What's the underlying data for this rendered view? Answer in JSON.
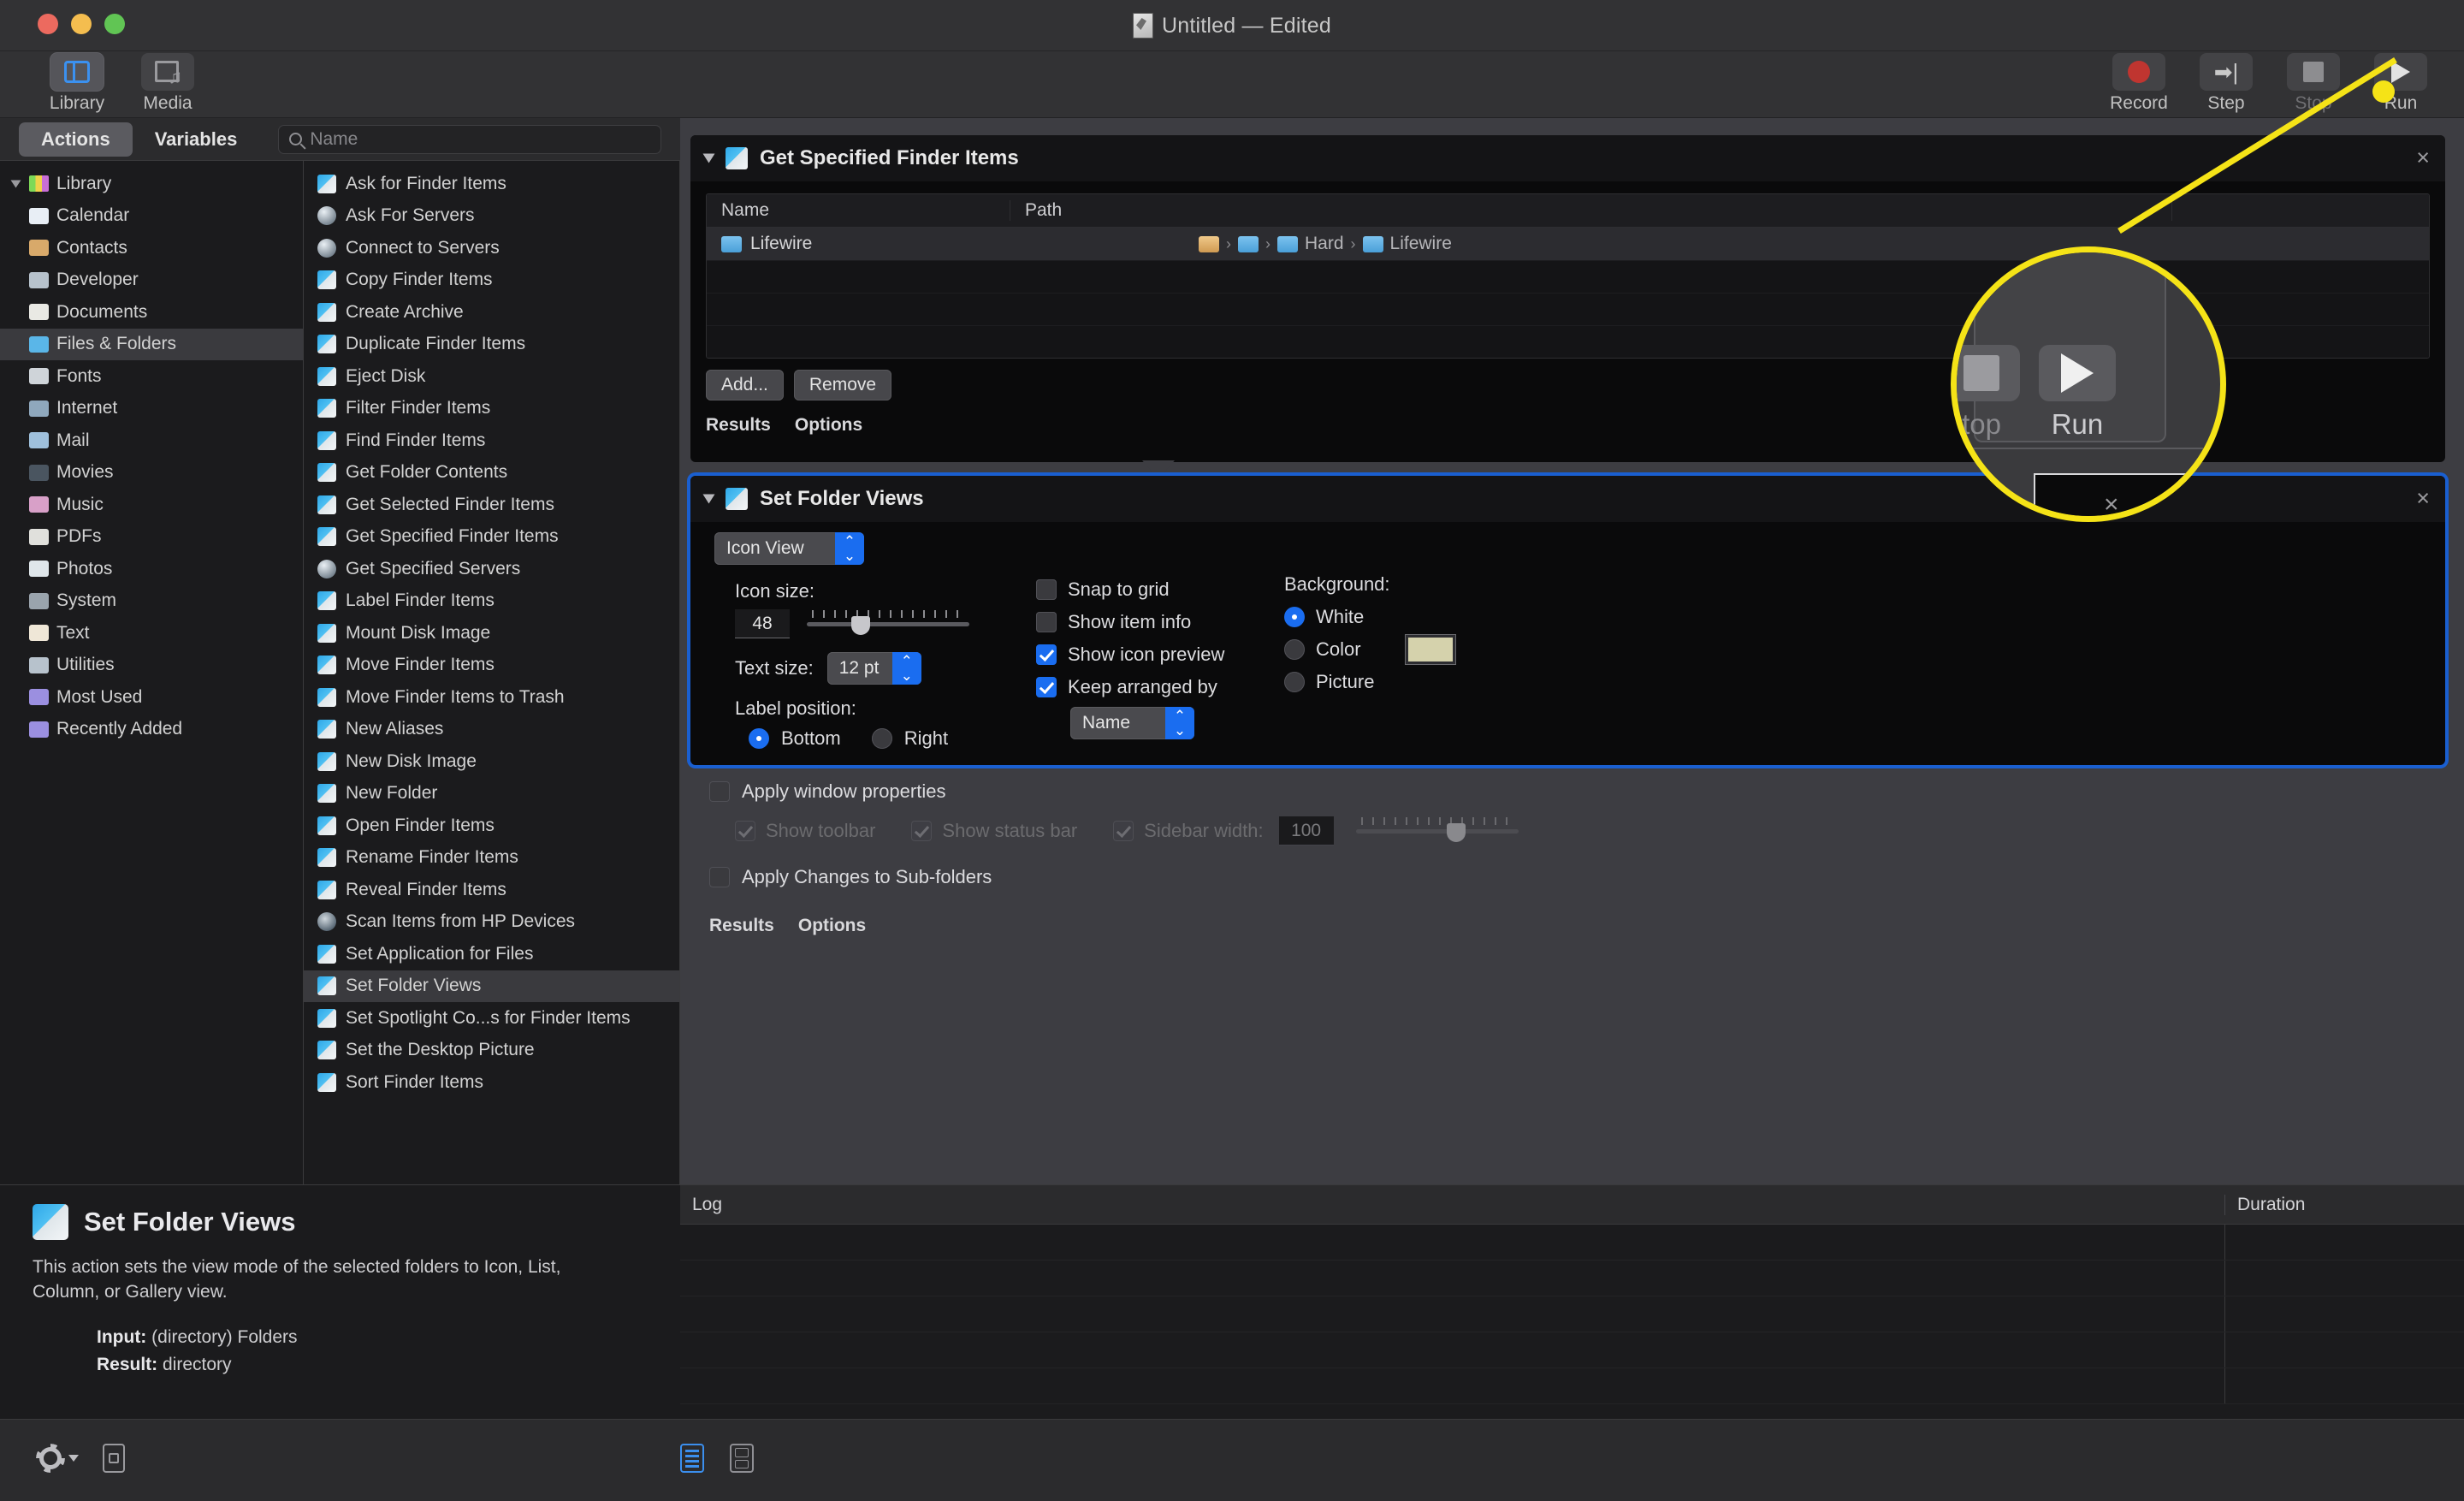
{
  "window": {
    "title": "Untitled — Edited",
    "traffic_lights": [
      "close",
      "minimize",
      "zoom"
    ]
  },
  "toolbar": {
    "left": [
      {
        "label": "Library",
        "icon": "library-icon",
        "selected": true
      },
      {
        "label": "Media",
        "icon": "media-icon",
        "selected": false
      }
    ],
    "right": [
      {
        "label": "Record",
        "icon": "record-icon",
        "enabled": true
      },
      {
        "label": "Step",
        "icon": "step-icon",
        "enabled": true
      },
      {
        "label": "Stop",
        "icon": "stop-icon",
        "enabled": false
      },
      {
        "label": "Run",
        "icon": "run-icon",
        "enabled": true
      }
    ]
  },
  "tabs": {
    "actions": "Actions",
    "variables": "Variables"
  },
  "search": {
    "placeholder": "Name",
    "value": ""
  },
  "library": {
    "root": "Library",
    "items": [
      "Calendar",
      "Contacts",
      "Developer",
      "Documents",
      "Files & Folders",
      "Fonts",
      "Internet",
      "Mail",
      "Movies",
      "Music",
      "PDFs",
      "Photos",
      "System",
      "Text",
      "Utilities"
    ],
    "selected": "Files & Folders",
    "groups": [
      "Most Used",
      "Recently Added"
    ]
  },
  "actions_list": {
    "items": [
      {
        "label": "Ask for Finder Items",
        "icon": "finder-icon"
      },
      {
        "label": "Ask For Servers",
        "icon": "globe-icon"
      },
      {
        "label": "Connect to Servers",
        "icon": "globe-icon"
      },
      {
        "label": "Copy Finder Items",
        "icon": "finder-icon"
      },
      {
        "label": "Create Archive",
        "icon": "finder-icon"
      },
      {
        "label": "Duplicate Finder Items",
        "icon": "finder-icon"
      },
      {
        "label": "Eject Disk",
        "icon": "finder-icon"
      },
      {
        "label": "Filter Finder Items",
        "icon": "finder-icon"
      },
      {
        "label": "Find Finder Items",
        "icon": "finder-icon"
      },
      {
        "label": "Get Folder Contents",
        "icon": "finder-icon"
      },
      {
        "label": "Get Selected Finder Items",
        "icon": "finder-icon"
      },
      {
        "label": "Get Specified Finder Items",
        "icon": "finder-icon"
      },
      {
        "label": "Get Specified Servers",
        "icon": "globe-icon"
      },
      {
        "label": "Label Finder Items",
        "icon": "finder-icon"
      },
      {
        "label": "Mount Disk Image",
        "icon": "finder-icon"
      },
      {
        "label": "Move Finder Items",
        "icon": "finder-icon"
      },
      {
        "label": "Move Finder Items to Trash",
        "icon": "finder-icon"
      },
      {
        "label": "New Aliases",
        "icon": "finder-icon"
      },
      {
        "label": "New Disk Image",
        "icon": "finder-icon"
      },
      {
        "label": "New Folder",
        "icon": "finder-icon"
      },
      {
        "label": "Open Finder Items",
        "icon": "finder-icon"
      },
      {
        "label": "Rename Finder Items",
        "icon": "finder-icon"
      },
      {
        "label": "Reveal Finder Items",
        "icon": "finder-icon"
      },
      {
        "label": "Scan Items from HP Devices",
        "icon": "scanner-icon"
      },
      {
        "label": "Set Application for Files",
        "icon": "finder-icon"
      },
      {
        "label": "Set Folder Views",
        "icon": "finder-icon"
      },
      {
        "label": "Set Spotlight Co...s for Finder Items",
        "icon": "finder-icon"
      },
      {
        "label": "Set the Desktop Picture",
        "icon": "finder-icon"
      },
      {
        "label": "Sort Finder Items",
        "icon": "finder-icon"
      }
    ],
    "selected": "Set Folder Views"
  },
  "workflow": {
    "action1": {
      "title": "Get Specified Finder Items",
      "columns": {
        "name": "Name",
        "path": "Path"
      },
      "rows": [
        {
          "name": "Lifewire",
          "path_segments": [
            "Hard",
            "Lifewire"
          ]
        }
      ],
      "buttons": {
        "add": "Add...",
        "remove": "Remove"
      },
      "tabs": {
        "results": "Results",
        "options": "Options"
      },
      "close": "×"
    },
    "action2": {
      "title": "Set Folder Views",
      "view_mode": "Icon View",
      "icon_size_label": "Icon size:",
      "icon_size_value": "48",
      "text_size_label": "Text size:",
      "text_size_value": "12 pt",
      "label_position_label": "Label position:",
      "label_position_options": [
        "Bottom",
        "Right"
      ],
      "label_position_selected": "Bottom",
      "checkboxes": [
        {
          "label": "Snap to grid",
          "checked": false
        },
        {
          "label": "Show item info",
          "checked": false
        },
        {
          "label": "Show icon preview",
          "checked": true
        },
        {
          "label": "Keep arranged by",
          "checked": true
        }
      ],
      "arrange_by_value": "Name",
      "background_label": "Background:",
      "background_options": [
        "White",
        "Color",
        "Picture"
      ],
      "background_selected": "White",
      "background_swatch_color": "#d5d2ac",
      "apply_window_properties": {
        "label": "Apply window properties",
        "checked": false
      },
      "window_props": [
        {
          "label": "Show toolbar",
          "checked": true,
          "enabled": false
        },
        {
          "label": "Show status bar",
          "checked": true,
          "enabled": false
        },
        {
          "label": "Sidebar width:",
          "checked": true,
          "enabled": false
        }
      ],
      "sidebar_width_value": "100",
      "apply_subfolders": {
        "label": "Apply Changes to Sub-folders",
        "checked": false
      },
      "tabs": {
        "results": "Results",
        "options": "Options"
      },
      "close": "×"
    }
  },
  "log": {
    "columns": {
      "log": "Log",
      "duration": "Duration"
    },
    "rows": []
  },
  "info": {
    "title": "Set Folder Views",
    "description": "This action sets the view mode of the selected folders to Icon, List, Column, or Gallery view.",
    "input_label": "Input:",
    "input_value": "(directory) Folders",
    "result_label": "Result:",
    "result_value": "directory"
  },
  "bottom_bar": {
    "gear": "gear-icon",
    "chevron": "chevron-down-icon",
    "checkbox_icon": "checkbox-list-icon",
    "view_list": "list-view-icon",
    "view_group": "group-view-icon"
  },
  "callout": {
    "zoom_stop_label": "top",
    "zoom_run_label": "Run",
    "accent_color": "#f5e317"
  }
}
